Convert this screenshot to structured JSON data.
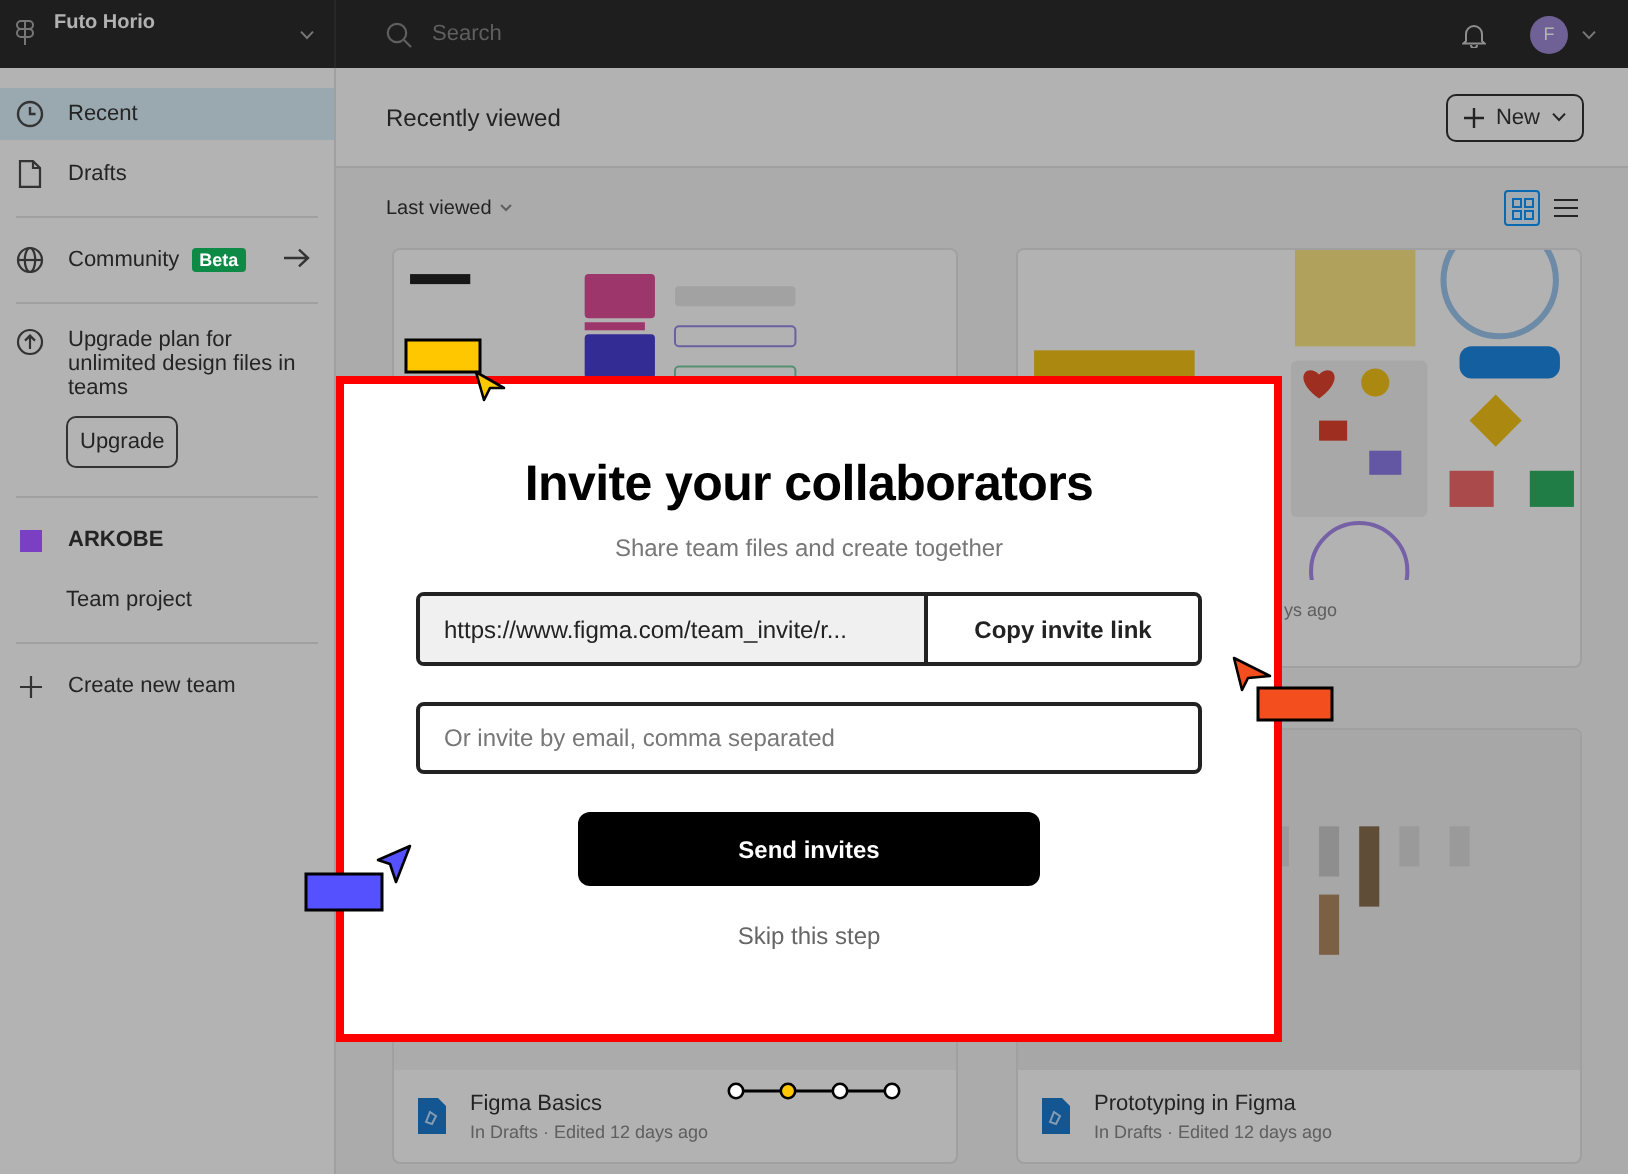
{
  "topbar": {
    "account": "Futo Horio",
    "search": {
      "placeholder": "Search"
    },
    "avatar": "F"
  },
  "sidebar": {
    "nav": [
      {
        "label": "Recent",
        "selected": true
      },
      {
        "label": "Drafts",
        "selected": false
      }
    ],
    "community": {
      "label": "Community",
      "badge": "Beta"
    },
    "upgrade": {
      "text": "Upgrade plan for unlimited design files in teams",
      "button": "Upgrade"
    },
    "team": {
      "name": "ARKOBE",
      "color": "#7b3fc4",
      "project": "Team project"
    },
    "create_team": "Create new team"
  },
  "main": {
    "title": "Recently viewed",
    "new_button": "New",
    "sort": "Last viewed",
    "view_modes": [
      {
        "kind": "grid",
        "selected": true
      },
      {
        "kind": "list",
        "selected": false
      }
    ],
    "files": [
      {
        "kind": "picture"
      },
      {
        "kind": "picture",
        "meta": "ys ago"
      },
      {
        "kind": "picture",
        "title": "Figma Basics",
        "meta": "In Drafts · Edited 12 days ago"
      },
      {
        "kind": "picture",
        "title": "Prototyping in Figma",
        "meta": "In Drafts · Edited 12 days ago"
      }
    ]
  },
  "modal": {
    "title": "Invite your collaborators",
    "subtitle": "Share team files and create together",
    "invite_link": "https://www.figma.com/team_invite/r...",
    "copy_button": "Copy invite link",
    "email": {
      "placeholder": "Or invite by email, comma separated"
    },
    "send_button": "Send invites",
    "skip": "Skip this step"
  }
}
